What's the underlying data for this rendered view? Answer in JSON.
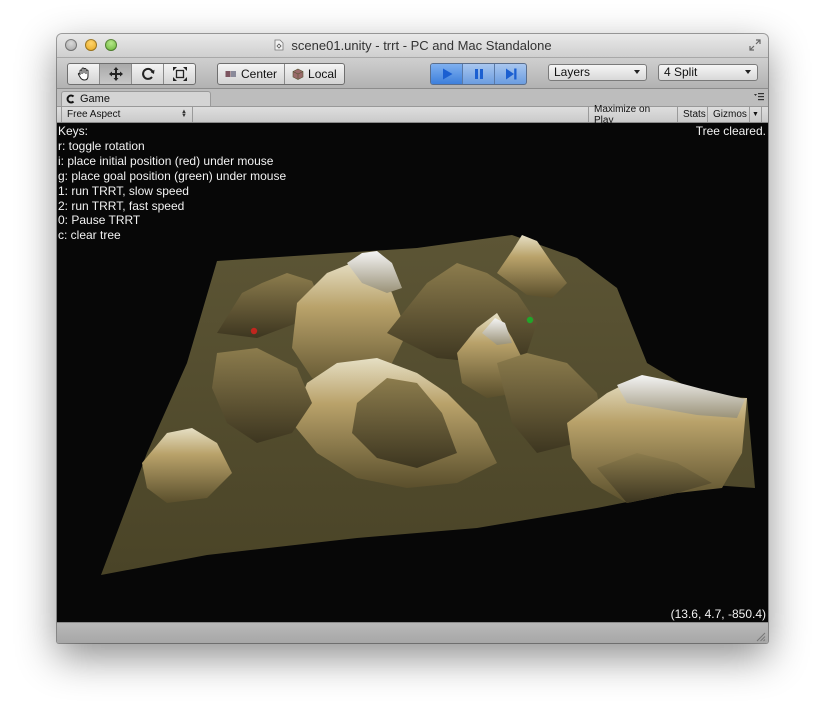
{
  "window": {
    "title": "scene01.unity - trrt - PC and Mac Standalone"
  },
  "toolbar": {
    "tools": [
      {
        "name": "hand-tool",
        "icon": "hand-icon"
      },
      {
        "name": "move-tool",
        "icon": "move-arrows-icon",
        "active": true
      },
      {
        "name": "rotate-tool",
        "icon": "rotate-icon"
      },
      {
        "name": "scale-tool",
        "icon": "scale-icon"
      }
    ],
    "pivot_label": "Center",
    "space_label": "Local",
    "play": {
      "play_icon": "play-icon",
      "pause_icon": "pause-icon",
      "step_icon": "step-icon",
      "playing": true
    },
    "layers_label": "Layers",
    "layout_label": "4 Split"
  },
  "tab": {
    "label": "Game",
    "icon": "game-controller-icon"
  },
  "game_toolbar": {
    "aspect_label": "Free Aspect",
    "maximize_label": "Maximize on Play",
    "stats_label": "Stats",
    "gizmos_label": "Gizmos"
  },
  "viewport": {
    "keys": [
      "Keys:",
      "r: toggle rotation",
      "i: place initial position (red) under mouse",
      "g: place goal position (green) under mouse",
      "1: run TRRT, slow speed",
      "2: run TRRT, fast speed",
      "0: Pause TRRT",
      "c: clear tree"
    ],
    "status": "Tree cleared.",
    "coords": "(13.6, 4.7, -850.4)",
    "colors": {
      "initial_marker": "#c0261e",
      "goal_marker": "#21a52a",
      "background": "#070707"
    }
  }
}
